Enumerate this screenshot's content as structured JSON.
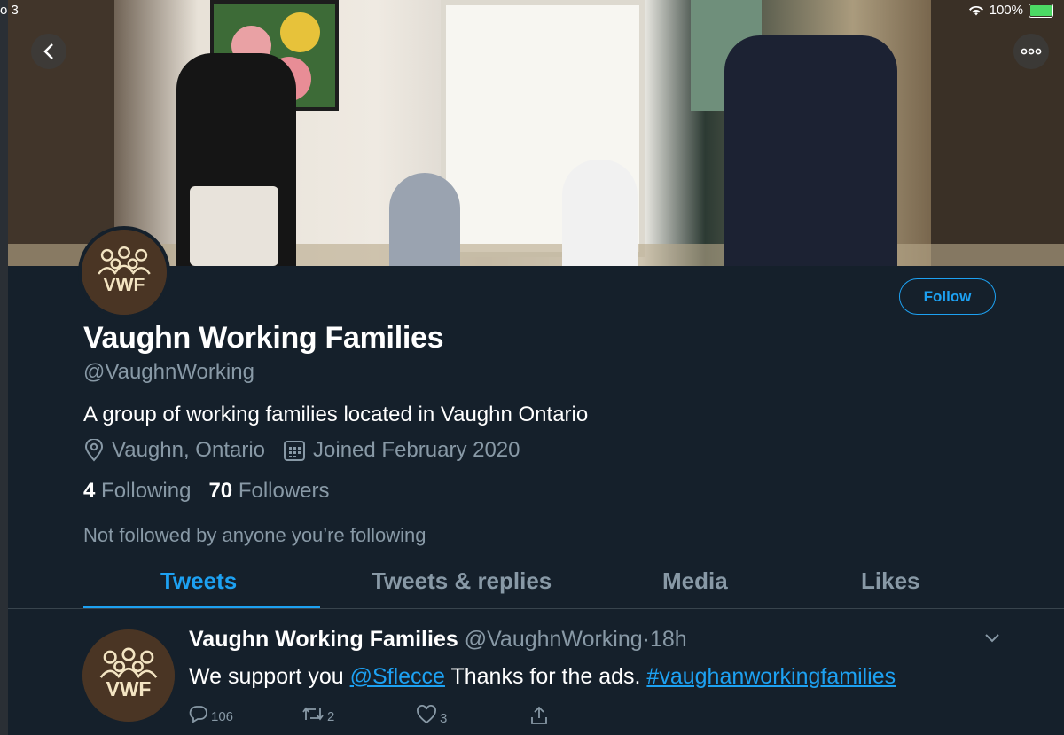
{
  "status_bar": {
    "carrier": "o 3",
    "battery": "100%",
    "battery_level": 1.0,
    "wifi_icon": "wifi-icon"
  },
  "colors": {
    "background": "#15202b",
    "accent": "#1da1f2",
    "muted": "#8899a6"
  },
  "profile": {
    "avatar_text": "VWF",
    "name": "Vaughn Working Families",
    "handle": "@VaughnWorking",
    "bio": "A group of working families located in Vaughn Ontario",
    "location": "Vaughn, Ontario",
    "joined": "Joined February 2020",
    "following_count": "4",
    "following_label": "Following",
    "followers_count": "70",
    "followers_label": "Followers",
    "follow_context": "Not followed by anyone you’re following",
    "follow_button": "Follow"
  },
  "tabs": [
    {
      "label": "Tweets",
      "active": true
    },
    {
      "label": "Tweets & replies",
      "active": false
    },
    {
      "label": "Media",
      "active": false
    },
    {
      "label": "Likes",
      "active": false
    }
  ],
  "tweet": {
    "author": "Vaughn Working Families",
    "handle": "@VaughnWorking",
    "separator": "·",
    "time": "18h",
    "text_start": "We support you",
    "mention": "@Sflecce",
    "text_middle": " Thanks for the ads. ",
    "hashtag": "#vaughanworkingfamilies",
    "replies": "106",
    "retweets": "2",
    "likes": "3"
  }
}
